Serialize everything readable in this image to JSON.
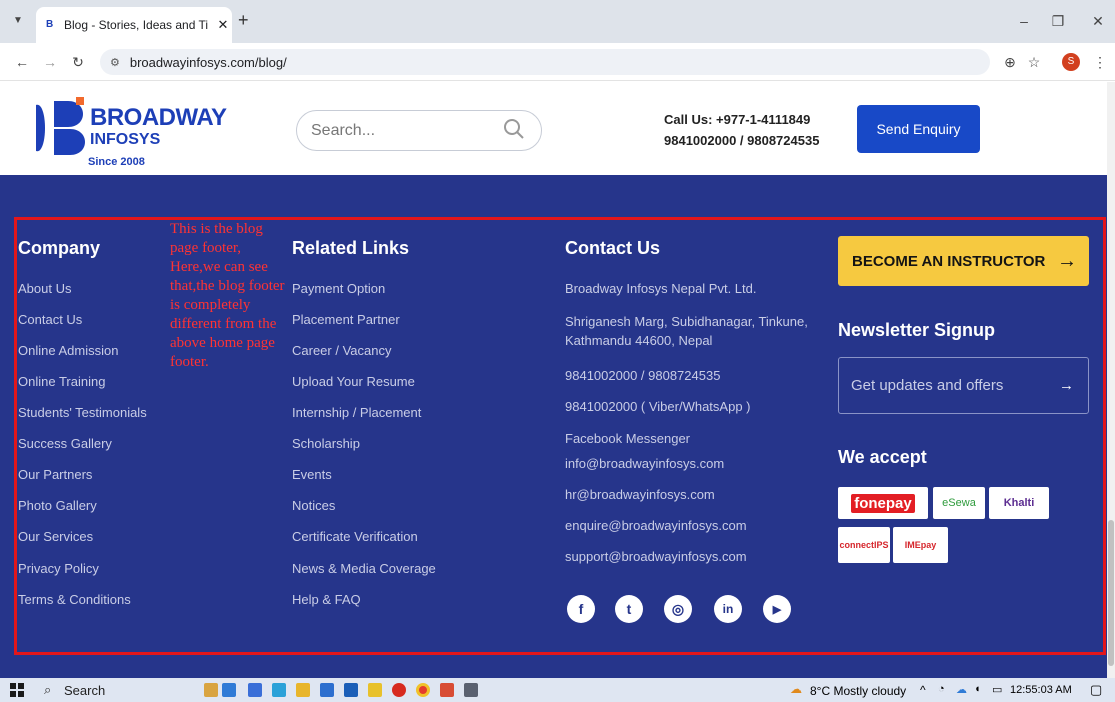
{
  "browser": {
    "tab_title": "Blog - Stories, Ideas and Tips | B",
    "url": "broadwayinfosys.com/blog/",
    "new_tab": "+",
    "profile_initial": "S"
  },
  "header": {
    "logo_line1": "BROADWAY",
    "logo_line2": "INFOSYS",
    "logo_since": "Since 2008",
    "search_placeholder": "Search...",
    "call_label": "Call Us: +977-1-4111849",
    "call_numbers": "9841002000 / 9808724535",
    "enquiry_button": "Send Enquiry"
  },
  "annotation": "This is the blog page footer, Here,we can see that,the blog footer is completely different from the above home page footer.",
  "footer": {
    "company_title": "Company",
    "company_links": [
      "About Us",
      "Contact Us",
      "Online Admission",
      "Online Training",
      "Students' Testimonials",
      "Success Gallery",
      "Our Partners",
      "Photo Gallery",
      "Our Services",
      "Privacy Policy",
      "Terms & Conditions"
    ],
    "related_title": "Related Links",
    "related_links": [
      "Payment Option",
      "Placement Partner",
      "Career / Vacancy",
      "Upload Your Resume",
      "Internship / Placement",
      "Scholarship",
      "Events",
      "Notices",
      "Certificate Verification",
      "News & Media Coverage",
      "Help & FAQ"
    ],
    "contact_title": "Contact Us",
    "contact": {
      "company": "Broadway Infosys Nepal Pvt. Ltd.",
      "address": "Shriganesh Marg, Subidhanagar, Tinkune, Kathmandu 44600, Nepal",
      "phones": "9841002000 / 9808724535",
      "viber": "9841002000 ( Viber/WhatsApp )",
      "messenger": "Facebook Messenger",
      "email1": "info@broadwayinfosys.com",
      "email2": "hr@broadwayinfosys.com",
      "email3": "enquire@broadwayinfosys.com",
      "email4": "support@broadwayinfosys.com"
    },
    "instructor_button": "BECOME AN INSTRUCTOR",
    "newsletter_title": "Newsletter Signup",
    "newsletter_placeholder": "Get updates and offers",
    "accept_title": "We accept",
    "payments": [
      "fonepay",
      "eSewa",
      "Khalti",
      "connectIPS",
      "IMEpay"
    ]
  },
  "taskbar": {
    "search": "Search",
    "weather": "8°C  Mostly cloudy",
    "time": "12:55:03 AM"
  },
  "colors": {
    "footer_bg": "#26358b",
    "accent": "#1849c7",
    "instructor": "#f6c940",
    "annotation_box": "#e3161b"
  }
}
